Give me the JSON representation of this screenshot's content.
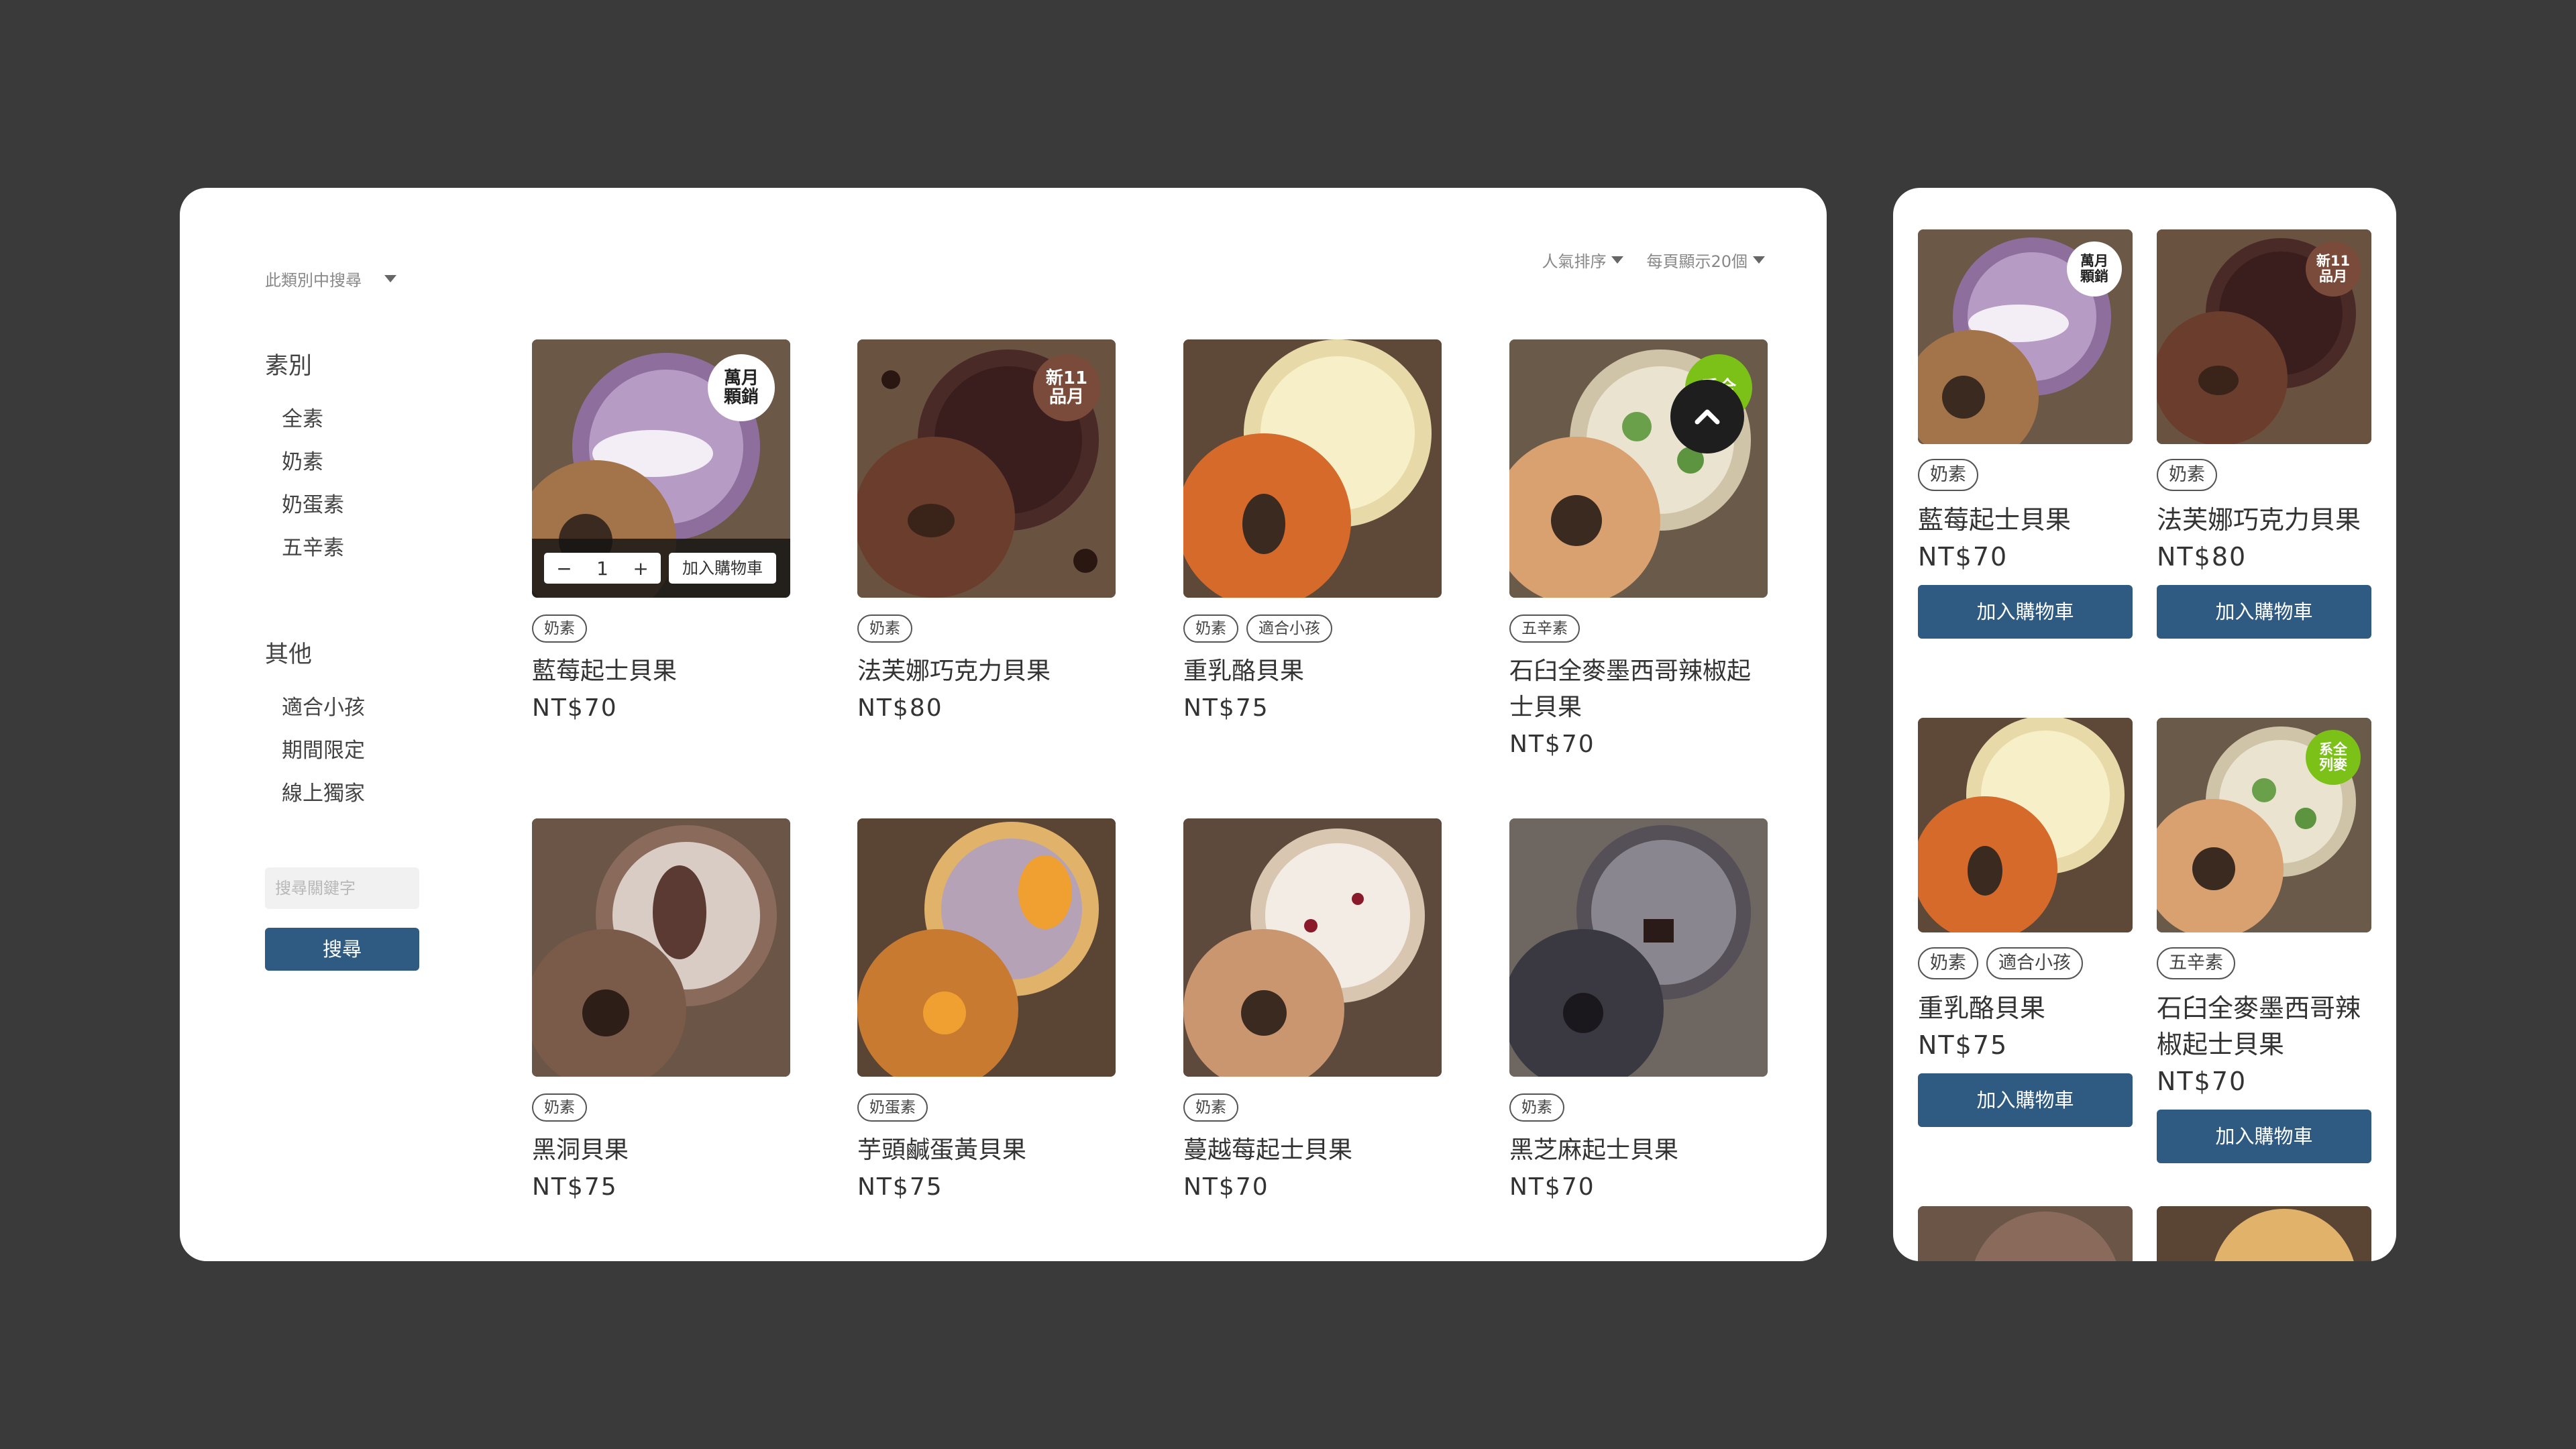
{
  "desktop": {
    "category_search": "此類別中搜尋",
    "sort_popularity": "人氣排序",
    "per_page": "每頁顯示20個",
    "sidebar": {
      "group1_title": "素別",
      "group1_items": [
        "全素",
        "奶素",
        "奶蛋素",
        "五辛素"
      ],
      "group2_title": "其他",
      "group2_items": [
        "適合小孩",
        "期間限定",
        "線上獨家"
      ]
    },
    "search_placeholder": "搜尋關鍵字",
    "search_button": "搜尋",
    "quick_add": {
      "qty_minus": "−",
      "qty_value": "1",
      "qty_plus": "+",
      "add_label": "加入購物車"
    },
    "products": [
      {
        "name": "藍莓起士貝果",
        "price": "NT$70",
        "tags": [
          "奶素"
        ],
        "badge": "萬月\n顆銷"
      },
      {
        "name": "法芙娜巧克力貝果",
        "price": "NT$80",
        "tags": [
          "奶素"
        ],
        "badge": "新11\n品月"
      },
      {
        "name": "重乳酪貝果",
        "price": "NT$75",
        "tags": [
          "奶素",
          "適合小孩"
        ],
        "badge": ""
      },
      {
        "name": "石臼全麥墨西哥辣椒起士貝果",
        "price": "NT$70",
        "tags": [
          "五辛素"
        ],
        "badge": "系全"
      },
      {
        "name": "黑洞貝果",
        "price": "NT$75",
        "tags": [
          "奶素"
        ],
        "badge": ""
      },
      {
        "name": "芋頭鹹蛋黃貝果",
        "price": "NT$75",
        "tags": [
          "奶蛋素"
        ],
        "badge": ""
      },
      {
        "name": "蔓越莓起士貝果",
        "price": "NT$70",
        "tags": [
          "奶素"
        ],
        "badge": ""
      },
      {
        "name": "黑芝麻起士貝果",
        "price": "NT$70",
        "tags": [
          "奶素"
        ],
        "badge": ""
      }
    ]
  },
  "mobile": {
    "add_to_cart": "加入購物車",
    "products": [
      {
        "name": "藍莓起士貝果",
        "price": "NT$70",
        "tags": [
          "奶素"
        ],
        "badge": "萬月\n顆銷"
      },
      {
        "name": "法芙娜巧克力貝果",
        "price": "NT$80",
        "tags": [
          "奶素"
        ],
        "badge": "新11\n品月"
      },
      {
        "name": "重乳酪貝果",
        "price": "NT$75",
        "tags": [
          "奶素",
          "適合小孩"
        ],
        "badge": ""
      },
      {
        "name": "石臼全麥墨西哥辣椒起士貝果",
        "price": "NT$70",
        "tags": [
          "五辛素"
        ],
        "badge": "系全\n列麥"
      }
    ]
  }
}
